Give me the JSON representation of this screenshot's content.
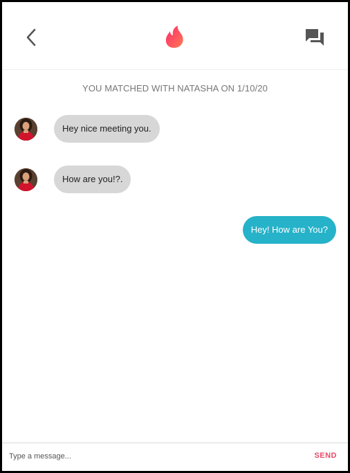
{
  "header": {
    "back_icon": "chevron-left-icon",
    "logo_icon": "flame-icon",
    "messages_icon": "chat-bubbles-icon",
    "logo_gradient": [
      "#fd2b6c",
      "#ff7854"
    ],
    "icon_color": "#555555"
  },
  "match_banner": "YOU MATCHED WITH NATASHA ON 1/10/20",
  "messages": [
    {
      "direction": "incoming",
      "text": "Hey nice meeting you."
    },
    {
      "direction": "incoming",
      "text": "How are you!?."
    },
    {
      "direction": "outgoing",
      "text": "Hey! How are You?"
    }
  ],
  "composer": {
    "placeholder": "Type a message...",
    "send_label": "SEND"
  },
  "colors": {
    "incoming_bubble": "#d7d7d7",
    "outgoing_bubble": "#26b2c9",
    "send": "#e84a67"
  }
}
